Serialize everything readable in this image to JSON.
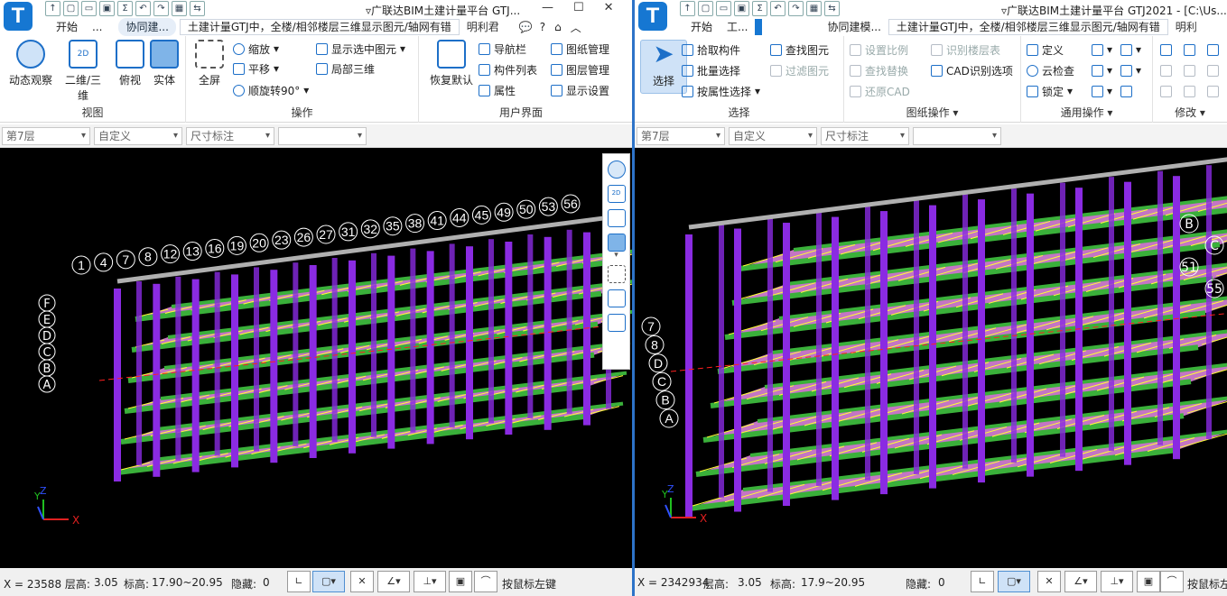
{
  "left": {
    "logo": "T",
    "title": "▿广联达BIM土建计量平台 GTJ...",
    "tabs": [
      "开始",
      "...",
      "协同建...",
      "土建计量GTJ中，全楼/相邻楼层三维显示图元/轴网有错",
      "明利君"
    ],
    "ribbon": {
      "groups": [
        {
          "label": "视图",
          "buttons": [
            "动态观察",
            "二维/三维",
            "俯视",
            "实体"
          ]
        },
        {
          "label": "操作",
          "big": "全屏",
          "small": [
            "缩放",
            "平移",
            "顺旋转90°",
            "显示选中图元",
            "局部三维"
          ]
        },
        {
          "label": "用户界面",
          "big": "恢复默认",
          "small": [
            "导航栏",
            "构件列表",
            "属性",
            "图纸管理",
            "图层管理",
            "显示设置"
          ]
        }
      ],
      "icon_2d_text": "2D"
    },
    "dropdowns": [
      "第7层",
      "自定义",
      "尺寸标注",
      ""
    ],
    "status": {
      "coord": "X = 23588 层高:",
      "floor_height": "3.05",
      "elev_label": "标高:",
      "elev": "17.90~20.95",
      "hidden_label": "隐藏:",
      "hidden": "0",
      "hint": "按鼠标左键"
    },
    "axis_labels": [
      "1",
      "4",
      "7",
      "8",
      "12",
      "13",
      "16",
      "19",
      "20",
      "23",
      "26",
      "27",
      "31",
      "32",
      "35",
      "38",
      "41",
      "44",
      "45",
      "49",
      "50",
      "53",
      "56",
      "F",
      "E",
      "D",
      "C",
      "B",
      "A"
    ]
  },
  "right": {
    "title": "▿广联达BIM土建计量平台 GTJ2021 - [C:\\Us...",
    "tabs": [
      "开始",
      "工...",
      "协同建模...",
      "土建计量GTJ中，全楼/相邻楼层三维显示图元/轴网有错",
      "明利"
    ],
    "ribbon": {
      "select_group": {
        "label": "选择",
        "big": "选择",
        "small": [
          "拾取构件",
          "批量选择",
          "按属性选择",
          "查找图元",
          "过滤图元"
        ]
      },
      "drawing_group": {
        "label": "图纸操作",
        "small": [
          "设置比例",
          "查找替换",
          "还原CAD",
          "识别楼层表",
          "CAD识别选项"
        ]
      },
      "common_group": {
        "label": "通用操作",
        "small": [
          "定义",
          "云检查",
          "锁定"
        ]
      },
      "modify_group": {
        "label": "修改"
      }
    },
    "dropdowns": [
      "第7层",
      "自定义",
      "尺寸标注",
      ""
    ],
    "status": {
      "coord": "X = 2342934",
      "fh_label": "层高:",
      "floor_height": "3.05",
      "elev_label": "标高:",
      "elev": "17.9~20.95",
      "hidden_label": "隐藏:",
      "hidden": "0",
      "hint": "按鼠标左键"
    },
    "axis_labels": [
      "7",
      "8",
      "D",
      "C",
      "B",
      "A",
      "B",
      "C",
      "51",
      "55"
    ]
  },
  "axis_gizmo": {
    "x": "X",
    "y": "Y",
    "z": "Z"
  },
  "colors": {
    "accent": "#1d6fc8",
    "beam": "#3ab03a",
    "column": "#8a2be2",
    "slab": "#e68ae6",
    "rebar": "#ffff33",
    "axis_red": "#ff2020"
  }
}
